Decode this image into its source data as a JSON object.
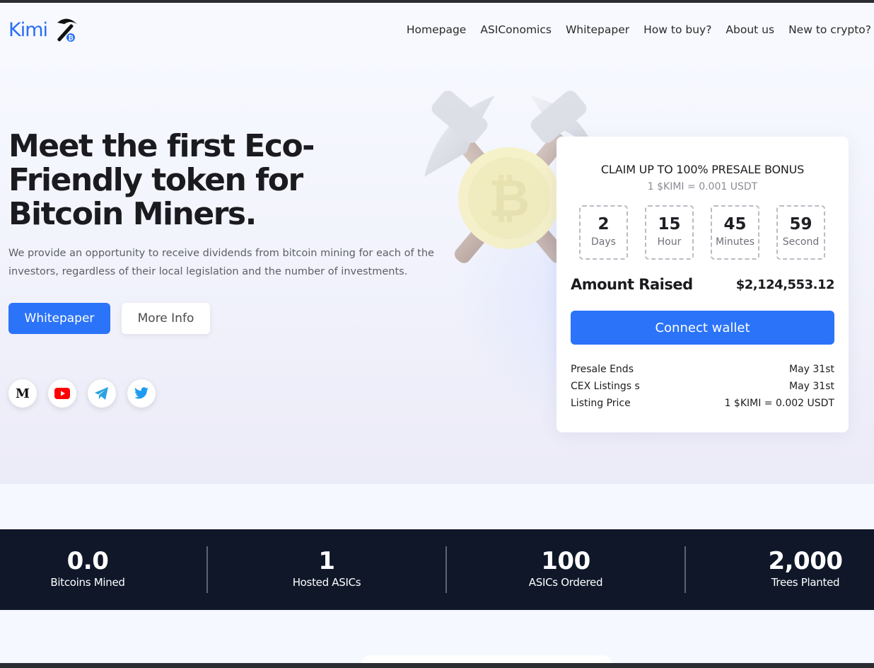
{
  "brand": {
    "name": "Kimi",
    "accent": "#2b73f8",
    "logo_icon": "pickaxe-bitcoin-icon"
  },
  "nav": [
    "Homepage",
    "ASIConomics",
    "Whitepaper",
    "How to buy?",
    "About us",
    "New to crypto?"
  ],
  "hero": {
    "title": "Meet the first Eco-Friendly token for Bitcoin Miners.",
    "description": "We provide an opportunity to receive dividends from bitcoin mining for each of the investors, regardless of their local legislation and the number of investments.",
    "primary_button": "Whitepaper",
    "secondary_button": "More Info",
    "socials": [
      "medium-icon",
      "youtube-icon",
      "telegram-icon",
      "twitter-icon"
    ]
  },
  "presale": {
    "title": "CLAIM UP TO 100% PRESALE BONUS",
    "rate": "1 $KIMI = 0.001 USDT",
    "countdown": [
      {
        "value": "2",
        "label": "Days"
      },
      {
        "value": "15",
        "label": "Hour"
      },
      {
        "value": "45",
        "label": "Minutes"
      },
      {
        "value": "59",
        "label": "Second"
      }
    ],
    "raised_label": "Amount Raised",
    "raised_value": "$2,124,553.12",
    "connect_button": "Connect wallet",
    "rows": [
      {
        "label": "Presale Ends",
        "value": "May 31st"
      },
      {
        "label": "CEX Listings s",
        "value": "May 31st"
      },
      {
        "label": "Listing Price",
        "value": "1 $KIMI = 0.002 USDT"
      }
    ]
  },
  "stats": [
    {
      "value": "0.0",
      "label": "Bitcoins Mined"
    },
    {
      "value": "1",
      "label": "Hosted ASICs"
    },
    {
      "value": "100",
      "label": "ASICs Ordered"
    },
    {
      "value": "2,000",
      "label": "Trees Planted"
    }
  ]
}
